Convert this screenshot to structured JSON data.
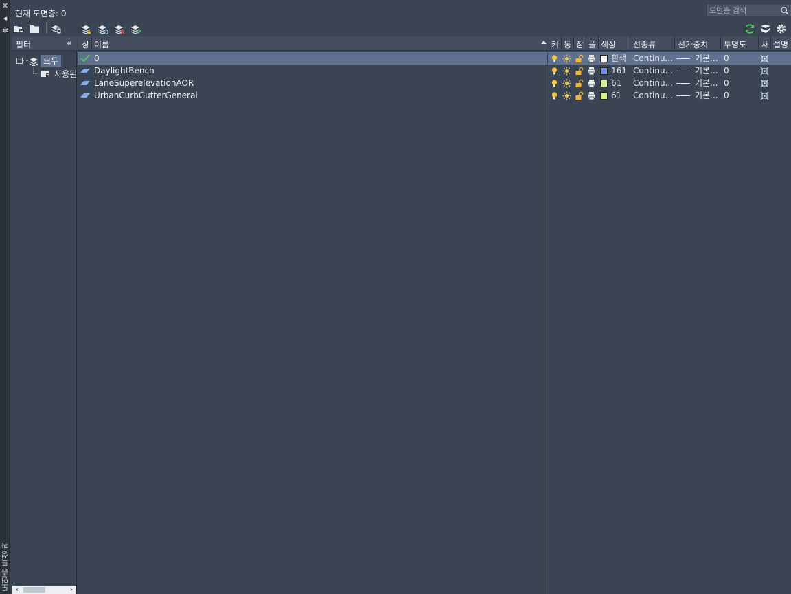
{
  "palette": {
    "shell_bg": "#3b4453",
    "header_bg": "#444e5f",
    "selection_bg": "#617190",
    "bulb_on": "#f5c342",
    "sun": "#f5c342",
    "lock_open": "#f0b43a",
    "refresh": "#49c35b",
    "check": "#4fc36a"
  },
  "side_strip": {
    "close_icon": "close-icon",
    "title": "도면층 특성 관리자"
  },
  "header": {
    "current_layer": "현재 도면층: 0",
    "search_placeholder": "도면층 검색",
    "toolbar_left": [
      "new-property-filter-icon",
      "new-group-filter-icon",
      "layer-states-manager-icon"
    ],
    "toolbar_mid": [
      "new-layer-icon",
      "new-layer-vp-frozen-icon",
      "delete-layer-icon",
      "set-current-icon"
    ],
    "toolbar_right": [
      "refresh-icon",
      "settings-icon",
      "gear-icon"
    ]
  },
  "filters": {
    "header": "필터",
    "collapse_label": "«",
    "tree": [
      {
        "label": "모두",
        "selected": true
      },
      {
        "label": "사용된 모든 도면층",
        "selected": false
      }
    ]
  },
  "columns_left": {
    "status": "상",
    "name": "이름"
  },
  "columns_right": [
    "켜",
    "동",
    "잠",
    "플",
    "색상",
    "선종류",
    "선가중치",
    "투명도",
    "새",
    "설명"
  ],
  "layers": [
    {
      "name": "0",
      "current": true,
      "selected": true,
      "on": true,
      "frozen": false,
      "locked": false,
      "plot": true,
      "color_name": "흰색",
      "color_hex": "#ffffff",
      "linetype": "Continu...",
      "lineweight": "기본...",
      "transparency": "0"
    },
    {
      "name": "DaylightBench",
      "current": false,
      "selected": false,
      "on": true,
      "frozen": false,
      "locked": false,
      "plot": true,
      "color_name": "161",
      "color_hex": "#6f8fe8",
      "linetype": "Continu...",
      "lineweight": "기본...",
      "transparency": "0"
    },
    {
      "name": "LaneSuperelevationAOR",
      "current": false,
      "selected": false,
      "on": true,
      "frozen": false,
      "locked": false,
      "plot": true,
      "color_name": "61",
      "color_hex": "#d6f38a",
      "linetype": "Continu...",
      "lineweight": "기본...",
      "transparency": "0"
    },
    {
      "name": "UrbanCurbGutterGeneral",
      "current": false,
      "selected": false,
      "on": true,
      "frozen": false,
      "locked": false,
      "plot": true,
      "color_name": "61",
      "color_hex": "#d6f38a",
      "linetype": "Continu...",
      "lineweight": "기본...",
      "transparency": "0"
    }
  ]
}
